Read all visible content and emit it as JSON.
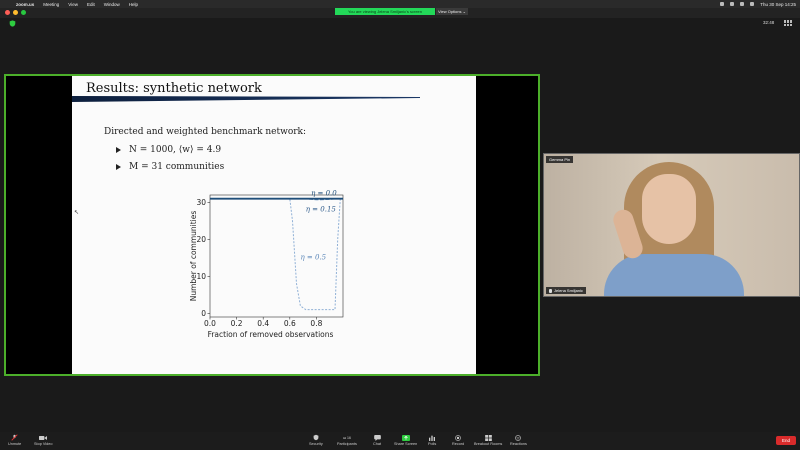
{
  "menubar": {
    "app_name": "zoom.us",
    "items": [
      "Meeting",
      "View",
      "Edit",
      "Window",
      "Help"
    ],
    "clock": "Thu 30 Sep  14:25"
  },
  "titlebar": {
    "banner": "You are viewing Jelena Smiljanic's screen",
    "view_options": "View Options ⌄"
  },
  "meeting": {
    "timer": "32:48"
  },
  "slide": {
    "title": "Results: synthetic network",
    "intro": "Directed and weighted benchmark network:",
    "bullets": [
      "N = 1000, ⟨w⟩ = 4.9",
      "M = 31 communities"
    ]
  },
  "chart_data": {
    "type": "line",
    "xlabel": "Fraction of removed observations",
    "ylabel": "Number of communities",
    "xlim": [
      0.0,
      1.0
    ],
    "ylim": [
      -1,
      32
    ],
    "xticks": [
      "0.0",
      "0.2",
      "0.4",
      "0.6",
      "0.8"
    ],
    "yticks": [
      "0",
      "10",
      "20",
      "30"
    ],
    "series": [
      {
        "name": "η = 0.0",
        "x": [
          0.0,
          0.1,
          0.2,
          0.3,
          0.4,
          0.5,
          0.6,
          0.7,
          0.8,
          0.9,
          0.95,
          1.0
        ],
        "y": [
          31,
          31,
          31,
          31,
          31,
          31,
          31,
          31,
          31,
          31,
          31,
          31
        ],
        "color": "#1f4e79",
        "dash": ""
      },
      {
        "name": "η = 0.15",
        "x": [
          0.0,
          0.2,
          0.4,
          0.6,
          0.7,
          0.8,
          0.9,
          0.95,
          0.98
        ],
        "y": [
          31,
          31,
          31,
          31,
          31,
          30.7,
          30.8,
          31,
          31
        ],
        "color": "#5a86b8",
        "dash": "4,1.5"
      },
      {
        "name": "η = 0.5",
        "x": [
          0.0,
          0.2,
          0.4,
          0.6,
          0.62,
          0.65,
          0.68,
          0.72,
          0.8,
          0.9,
          0.94,
          0.96,
          0.98
        ],
        "y": [
          31,
          31,
          31,
          31,
          25,
          8,
          2,
          1,
          1,
          1,
          1,
          20,
          31
        ],
        "color": "#8fb0d6",
        "dash": "2,1.5"
      }
    ],
    "annotations": [
      "η = 0.0",
      "η = 0.15",
      "η = 0.5"
    ]
  },
  "participant": {
    "label_top": "Gemma Pin",
    "label_bottom": "Jelena Smiljanic"
  },
  "toolbar": {
    "unmute": "Unmute",
    "stop_video": "Stop Video",
    "security": "Security",
    "participants": "Participants",
    "participants_count": "16",
    "chat": "Chat",
    "share_screen": "Share Screen",
    "polls": "Polls",
    "record": "Record",
    "breakout": "Breakout Rooms",
    "reactions": "Reactions",
    "end": "End"
  },
  "colors": {
    "share_border": "#4caf2a",
    "banner": "#23d959",
    "end": "#d92b2b"
  }
}
